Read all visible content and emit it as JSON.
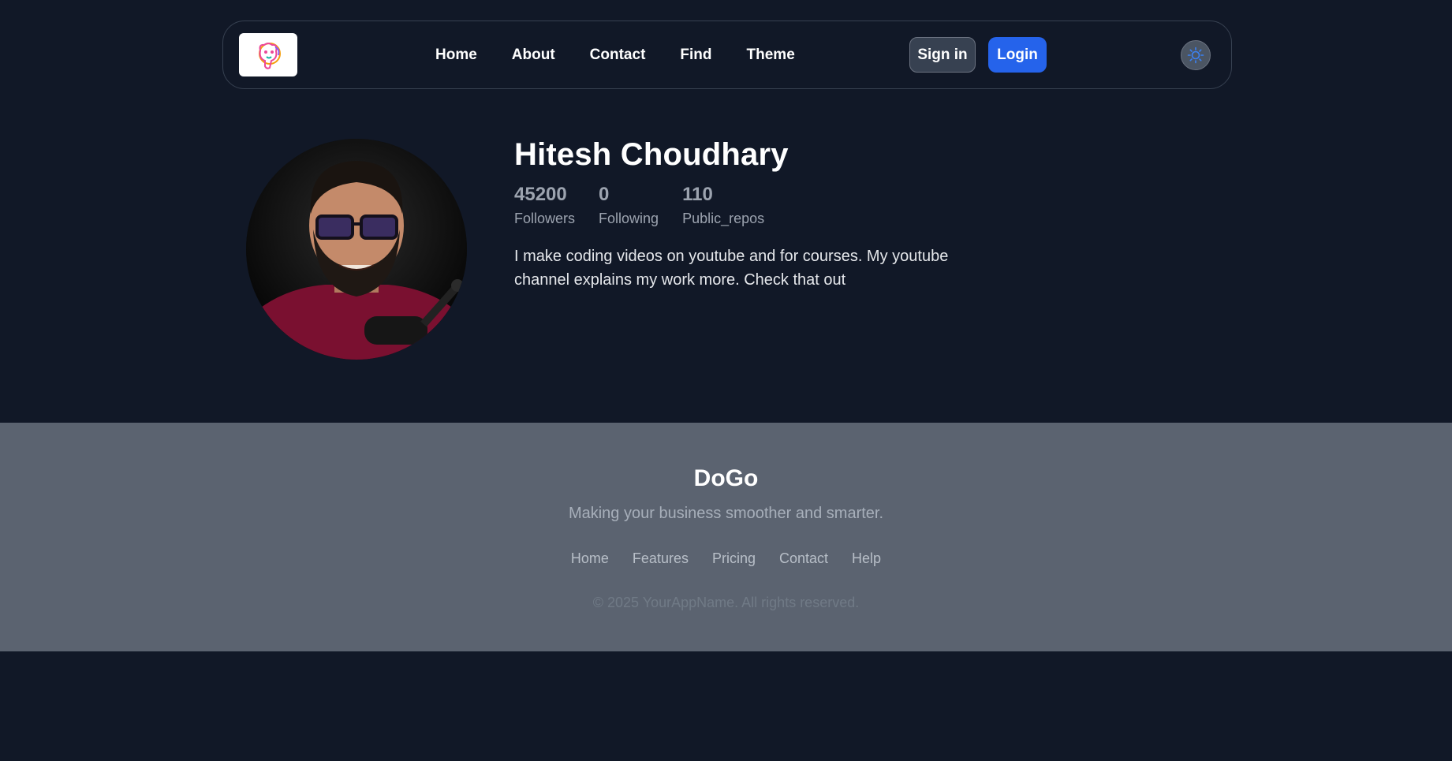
{
  "nav": {
    "logo_icon": "dog-logo-icon",
    "links": [
      "Home",
      "About",
      "Contact",
      "Find",
      "Theme"
    ],
    "signin_label": "Sign in",
    "login_label": "Login",
    "theme_toggle_icon": "sun-icon"
  },
  "profile": {
    "name": "Hitesh Choudhary",
    "stats": [
      {
        "value": "45200",
        "label": "Followers"
      },
      {
        "value": "0",
        "label": "Following"
      },
      {
        "value": "110",
        "label": "Public_repos"
      }
    ],
    "bio": "I make coding videos on youtube and for courses. My youtube channel explains my work more. Check that out"
  },
  "footer": {
    "brand": "DoGo",
    "tagline": "Making your business smoother and smarter.",
    "links": [
      "Home",
      "Features",
      "Pricing",
      "Contact",
      "Help"
    ],
    "copyright": "© 2025 YourAppName. All rights reserved."
  },
  "colors": {
    "background": "#111827",
    "accent": "#2563eb",
    "footer_bg": "#5b6370"
  }
}
